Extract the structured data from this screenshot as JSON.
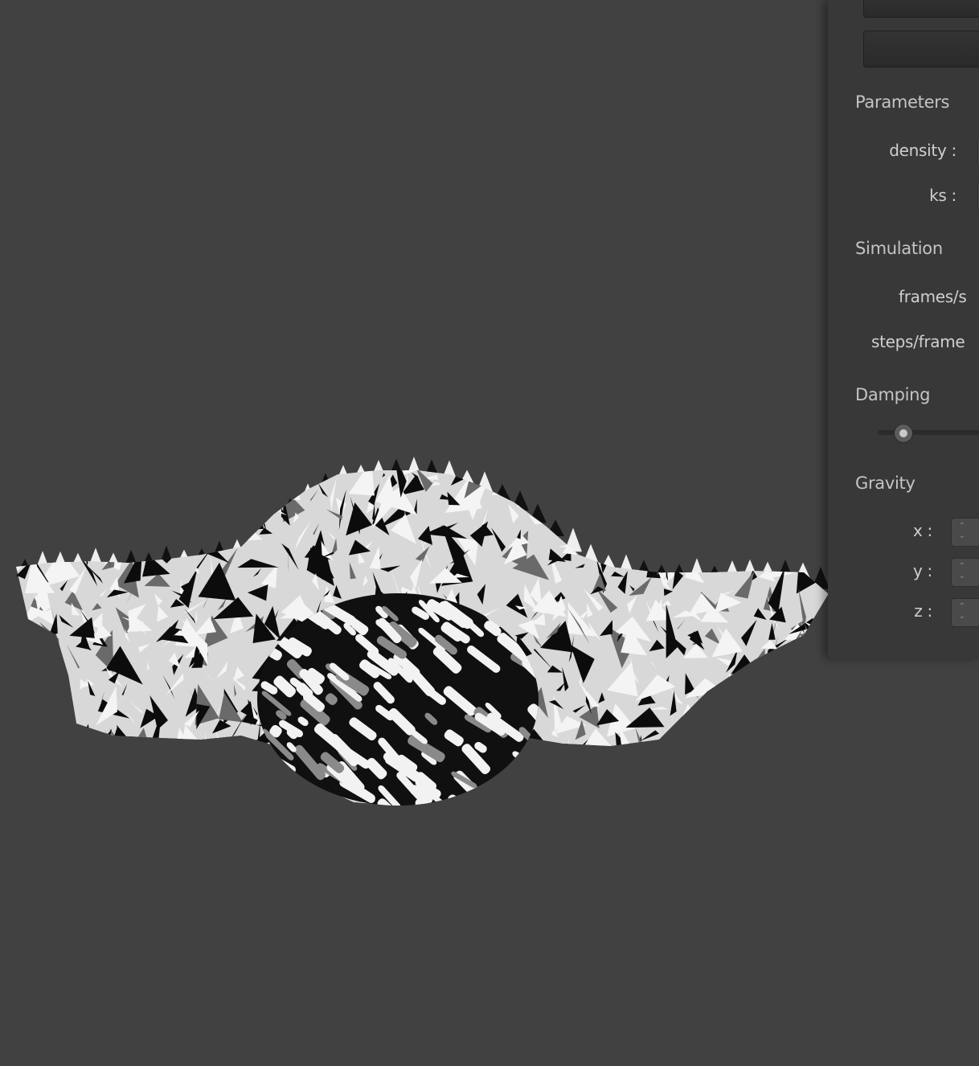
{
  "colors": {
    "background": "#414141",
    "panel": "#383838",
    "label": "#cfcfcf",
    "section": "#c4c4c4"
  },
  "panel": {
    "sections": {
      "parameters": "Parameters",
      "simulation": "Simulation",
      "damping": "Damping",
      "gravity": "Gravity"
    },
    "fields": {
      "density": "density :",
      "ks": "ks :",
      "frames_per_s": "frames/s",
      "steps_per_frame": "steps/frame",
      "x": "x :",
      "y": "y :",
      "z": "z :"
    },
    "damping_level": 0.2
  },
  "icons": {
    "spin_arrows": "up-down-arrows-icon",
    "slider": "slider-knob-icon"
  }
}
